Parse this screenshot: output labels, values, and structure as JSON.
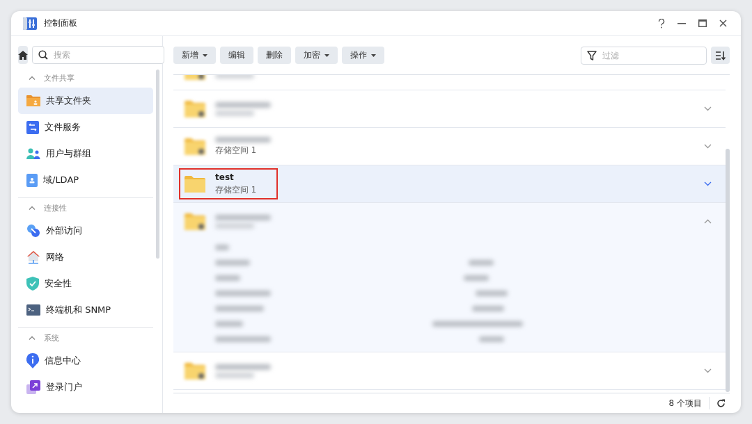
{
  "window": {
    "title": "控制面板"
  },
  "sidebar": {
    "search": {
      "placeholder": "搜索"
    },
    "sections": [
      {
        "title": "文件共享",
        "expanded": true,
        "items": [
          {
            "label": "共享文件夹",
            "selected": true
          },
          {
            "label": "文件服务",
            "selected": false
          },
          {
            "label": "用户与群组",
            "selected": false
          },
          {
            "label": "域/LDAP",
            "selected": false
          }
        ]
      },
      {
        "title": "连接性",
        "expanded": true,
        "items": [
          {
            "label": "外部访问",
            "selected": false
          },
          {
            "label": "网络",
            "selected": false
          },
          {
            "label": "安全性",
            "selected": false
          },
          {
            "label": "终端机和 SNMP",
            "selected": false
          }
        ]
      },
      {
        "title": "系统",
        "expanded": true,
        "items": [
          {
            "label": "信息中心",
            "selected": false
          },
          {
            "label": "登录门户",
            "selected": false
          }
        ]
      }
    ]
  },
  "toolbar": {
    "buttons": [
      {
        "label": "新增",
        "dropdown": true
      },
      {
        "label": "编辑",
        "dropdown": false
      },
      {
        "label": "删除",
        "dropdown": false
      },
      {
        "label": "加密",
        "dropdown": true
      },
      {
        "label": "操作",
        "dropdown": true
      }
    ],
    "filter": {
      "placeholder": "过滤"
    }
  },
  "rows": [
    {
      "selected": false,
      "expanded": false,
      "cut_off": true
    },
    {
      "selected": false,
      "expanded": false
    },
    {
      "selected": false,
      "expanded": false,
      "subtitle": "存储空间 1"
    },
    {
      "name": "test",
      "subtitle": "存储空间 1",
      "selected": true,
      "expanded": false
    },
    {
      "selected": false,
      "expanded": true
    },
    {
      "selected": false,
      "expanded": false
    }
  ],
  "status_bar": {
    "count": "8 个项目"
  }
}
